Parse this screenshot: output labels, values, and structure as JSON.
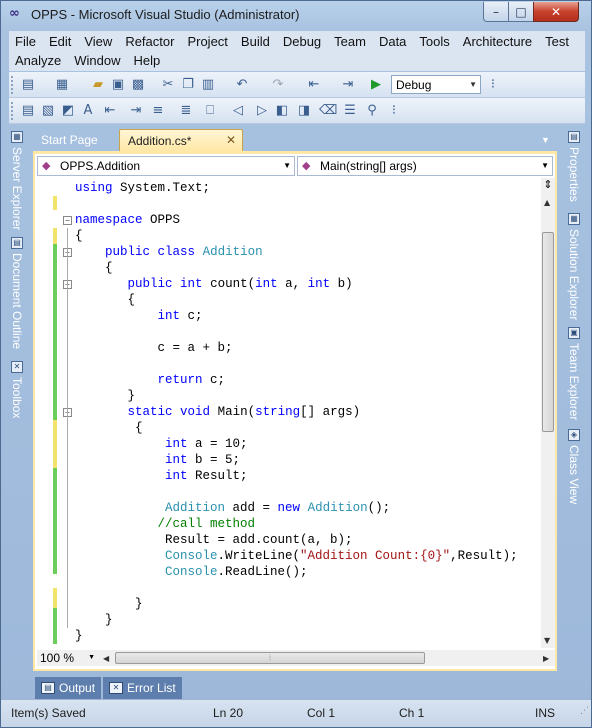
{
  "window": {
    "title": "OPPS - Microsoft Visual Studio (Administrator)",
    "minimize": "–",
    "maximize": "□",
    "close": "✕"
  },
  "menu": {
    "row1": [
      "File",
      "Edit",
      "View",
      "Refactor",
      "Project",
      "Build",
      "Debug",
      "Team",
      "Data",
      "Tools",
      "Architecture",
      "Test"
    ],
    "row2": [
      "Analyze",
      "Window",
      "Help"
    ]
  },
  "toolbar": {
    "configuration": "Debug"
  },
  "side_tabs": {
    "left": [
      "Server Explorer",
      "Document Outline",
      "Toolbox"
    ],
    "right": [
      "Properties",
      "Solution Explorer",
      "Team Explorer",
      "Class View"
    ]
  },
  "tabs": {
    "start_page": "Start Page",
    "active": "Addition.cs*",
    "close": "✕"
  },
  "navbar": {
    "type": "OPPS.Addition",
    "member": "Main(string[] args)"
  },
  "code": [
    "using System.Text;",
    "",
    "namespace OPPS",
    "{",
    "    public class Addition",
    "    {",
    "       public int count(int a, int b)",
    "       {",
    "           int c;",
    "",
    "           c = a + b;",
    "",
    "           return c;",
    "       }",
    "       static void Main(string[] args)",
    "        {",
    "            int a = 10;",
    "            int b = 5;",
    "            int Result;",
    "",
    "            Addition add = new Addition();",
    "           //call method",
    "            Result = add.count(a, b);",
    "            Console.WriteLine(\"Addition Count:{0}\",Result);",
    "            Console.ReadLine();",
    "",
    "        }",
    "    }",
    "}"
  ],
  "editor": {
    "zoom": "100 %"
  },
  "bottom_tabs": [
    "Output",
    "Error List"
  ],
  "status": {
    "message": "Item(s) Saved",
    "line": "Ln 20",
    "col": "Col 1",
    "ch": "Ch 1",
    "mode": "INS"
  }
}
